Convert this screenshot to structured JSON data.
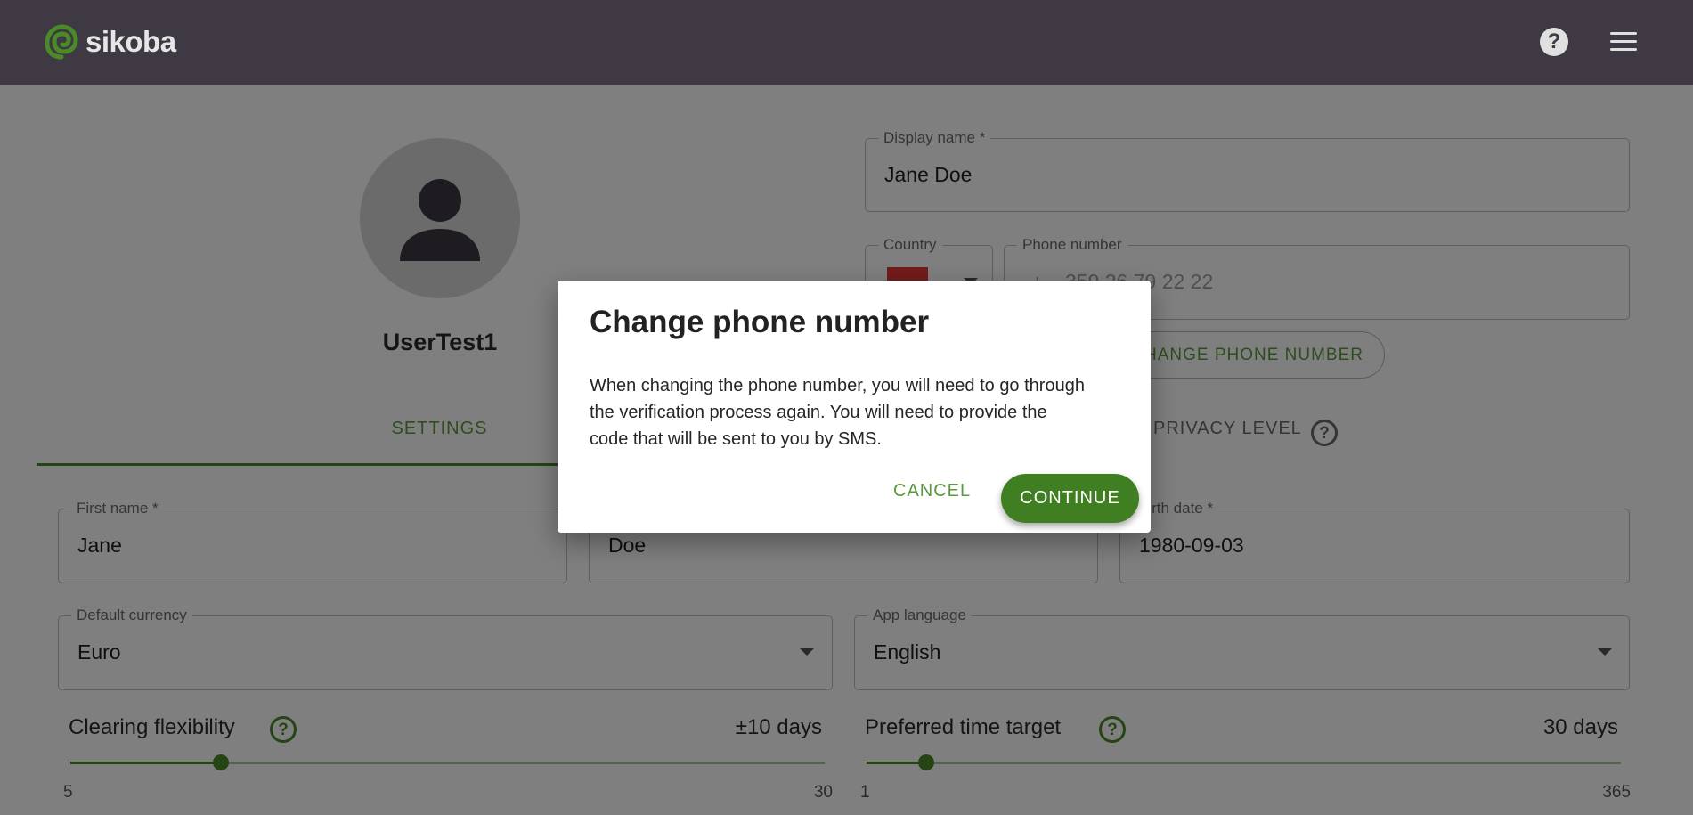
{
  "app": {
    "logo_text": "sikoba",
    "brand_green": "#4a8a28",
    "topbar_color": "#3e3942",
    "help_icon": "help-circle-icon",
    "menu_icon": "hamburger-menu-icon",
    "help_glyph": "?"
  },
  "profile": {
    "avatar_icon": "person-icon",
    "username": "UserTest1"
  },
  "display_name": {
    "label": "Display name *",
    "value": "Jane Doe"
  },
  "country": {
    "label": "Country",
    "flag_icon": "flag-icon"
  },
  "phone": {
    "label": "Phone number",
    "prefix": "+",
    "placeholder": "359 26 79 22 22"
  },
  "change_phone_button": "CHANGE PHONE NUMBER",
  "tabs": {
    "settings": "SETTINGS",
    "privacy": "PRIVACY LEVEL"
  },
  "first_name": {
    "label": "First name *",
    "value": "Jane"
  },
  "last_name": {
    "value": "Doe"
  },
  "birth_date": {
    "label": "Birth date *",
    "value": "1980-09-03"
  },
  "default_currency": {
    "label": "Default currency",
    "value": "Euro"
  },
  "app_language": {
    "label": "App language",
    "value": "English"
  },
  "clearing_flexibility": {
    "title": "Clearing flexibility",
    "value_text": "±10 days",
    "value": 10,
    "min": 5,
    "max": 30
  },
  "preferred_time_target": {
    "title": "Preferred time target",
    "value_text": "30 days",
    "value": 30,
    "min": 1,
    "max": 365
  },
  "dialog": {
    "title": "Change phone number",
    "body": "When changing the phone number, you will need to go through the verification process again. You will need to provide the code that will be sent to you by SMS.",
    "cancel": "CANCEL",
    "continue": "CONTINUE"
  }
}
